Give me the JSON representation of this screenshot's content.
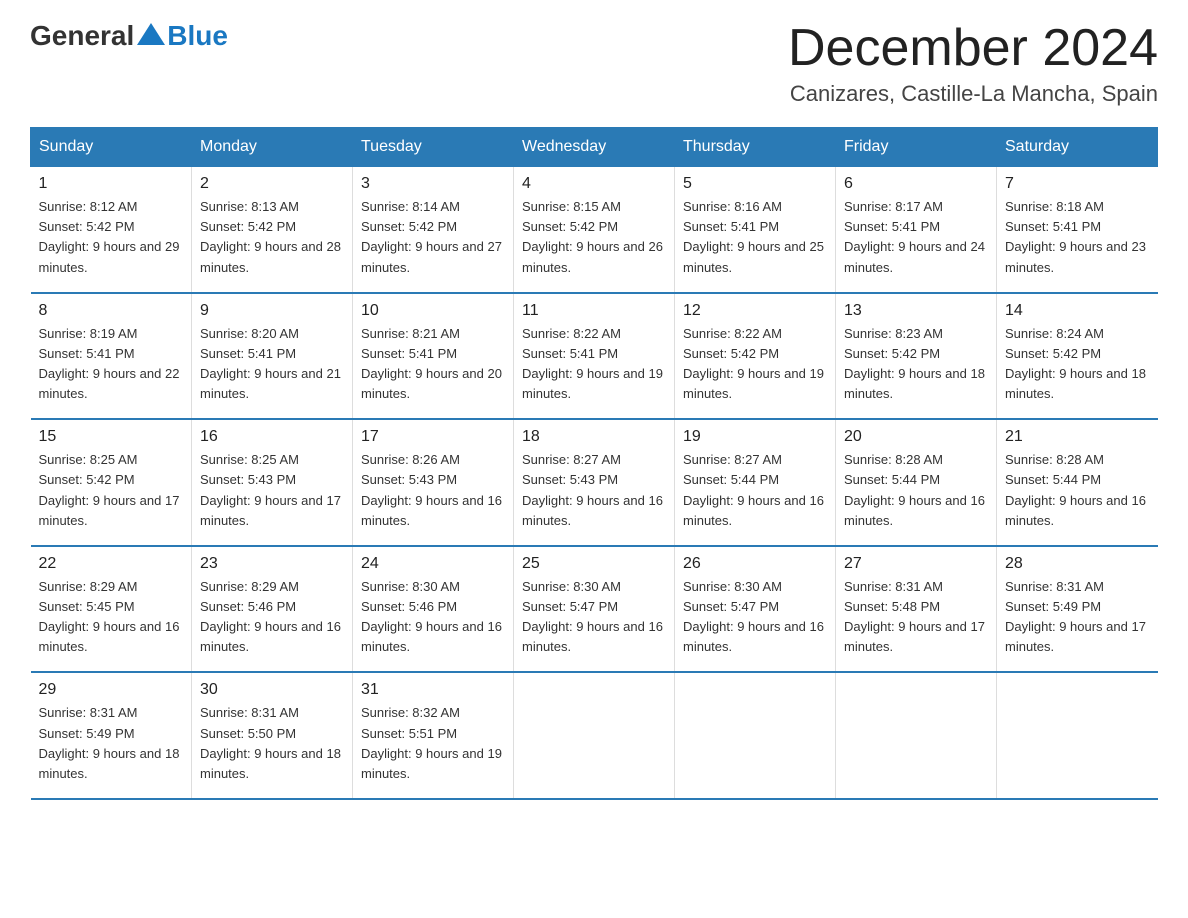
{
  "logo": {
    "text_general": "General",
    "text_blue": "Blue"
  },
  "title": "December 2024",
  "subtitle": "Canizares, Castille-La Mancha, Spain",
  "days_of_week": [
    "Sunday",
    "Monday",
    "Tuesday",
    "Wednesday",
    "Thursday",
    "Friday",
    "Saturday"
  ],
  "weeks": [
    [
      {
        "day": "1",
        "sunrise": "8:12 AM",
        "sunset": "5:42 PM",
        "daylight": "9 hours and 29 minutes."
      },
      {
        "day": "2",
        "sunrise": "8:13 AM",
        "sunset": "5:42 PM",
        "daylight": "9 hours and 28 minutes."
      },
      {
        "day": "3",
        "sunrise": "8:14 AM",
        "sunset": "5:42 PM",
        "daylight": "9 hours and 27 minutes."
      },
      {
        "day": "4",
        "sunrise": "8:15 AM",
        "sunset": "5:42 PM",
        "daylight": "9 hours and 26 minutes."
      },
      {
        "day": "5",
        "sunrise": "8:16 AM",
        "sunset": "5:41 PM",
        "daylight": "9 hours and 25 minutes."
      },
      {
        "day": "6",
        "sunrise": "8:17 AM",
        "sunset": "5:41 PM",
        "daylight": "9 hours and 24 minutes."
      },
      {
        "day": "7",
        "sunrise": "8:18 AM",
        "sunset": "5:41 PM",
        "daylight": "9 hours and 23 minutes."
      }
    ],
    [
      {
        "day": "8",
        "sunrise": "8:19 AM",
        "sunset": "5:41 PM",
        "daylight": "9 hours and 22 minutes."
      },
      {
        "day": "9",
        "sunrise": "8:20 AM",
        "sunset": "5:41 PM",
        "daylight": "9 hours and 21 minutes."
      },
      {
        "day": "10",
        "sunrise": "8:21 AM",
        "sunset": "5:41 PM",
        "daylight": "9 hours and 20 minutes."
      },
      {
        "day": "11",
        "sunrise": "8:22 AM",
        "sunset": "5:41 PM",
        "daylight": "9 hours and 19 minutes."
      },
      {
        "day": "12",
        "sunrise": "8:22 AM",
        "sunset": "5:42 PM",
        "daylight": "9 hours and 19 minutes."
      },
      {
        "day": "13",
        "sunrise": "8:23 AM",
        "sunset": "5:42 PM",
        "daylight": "9 hours and 18 minutes."
      },
      {
        "day": "14",
        "sunrise": "8:24 AM",
        "sunset": "5:42 PM",
        "daylight": "9 hours and 18 minutes."
      }
    ],
    [
      {
        "day": "15",
        "sunrise": "8:25 AM",
        "sunset": "5:42 PM",
        "daylight": "9 hours and 17 minutes."
      },
      {
        "day": "16",
        "sunrise": "8:25 AM",
        "sunset": "5:43 PM",
        "daylight": "9 hours and 17 minutes."
      },
      {
        "day": "17",
        "sunrise": "8:26 AM",
        "sunset": "5:43 PM",
        "daylight": "9 hours and 16 minutes."
      },
      {
        "day": "18",
        "sunrise": "8:27 AM",
        "sunset": "5:43 PM",
        "daylight": "9 hours and 16 minutes."
      },
      {
        "day": "19",
        "sunrise": "8:27 AM",
        "sunset": "5:44 PM",
        "daylight": "9 hours and 16 minutes."
      },
      {
        "day": "20",
        "sunrise": "8:28 AM",
        "sunset": "5:44 PM",
        "daylight": "9 hours and 16 minutes."
      },
      {
        "day": "21",
        "sunrise": "8:28 AM",
        "sunset": "5:44 PM",
        "daylight": "9 hours and 16 minutes."
      }
    ],
    [
      {
        "day": "22",
        "sunrise": "8:29 AM",
        "sunset": "5:45 PM",
        "daylight": "9 hours and 16 minutes."
      },
      {
        "day": "23",
        "sunrise": "8:29 AM",
        "sunset": "5:46 PM",
        "daylight": "9 hours and 16 minutes."
      },
      {
        "day": "24",
        "sunrise": "8:30 AM",
        "sunset": "5:46 PM",
        "daylight": "9 hours and 16 minutes."
      },
      {
        "day": "25",
        "sunrise": "8:30 AM",
        "sunset": "5:47 PM",
        "daylight": "9 hours and 16 minutes."
      },
      {
        "day": "26",
        "sunrise": "8:30 AM",
        "sunset": "5:47 PM",
        "daylight": "9 hours and 16 minutes."
      },
      {
        "day": "27",
        "sunrise": "8:31 AM",
        "sunset": "5:48 PM",
        "daylight": "9 hours and 17 minutes."
      },
      {
        "day": "28",
        "sunrise": "8:31 AM",
        "sunset": "5:49 PM",
        "daylight": "9 hours and 17 minutes."
      }
    ],
    [
      {
        "day": "29",
        "sunrise": "8:31 AM",
        "sunset": "5:49 PM",
        "daylight": "9 hours and 18 minutes."
      },
      {
        "day": "30",
        "sunrise": "8:31 AM",
        "sunset": "5:50 PM",
        "daylight": "9 hours and 18 minutes."
      },
      {
        "day": "31",
        "sunrise": "8:32 AM",
        "sunset": "5:51 PM",
        "daylight": "9 hours and 19 minutes."
      },
      null,
      null,
      null,
      null
    ]
  ]
}
